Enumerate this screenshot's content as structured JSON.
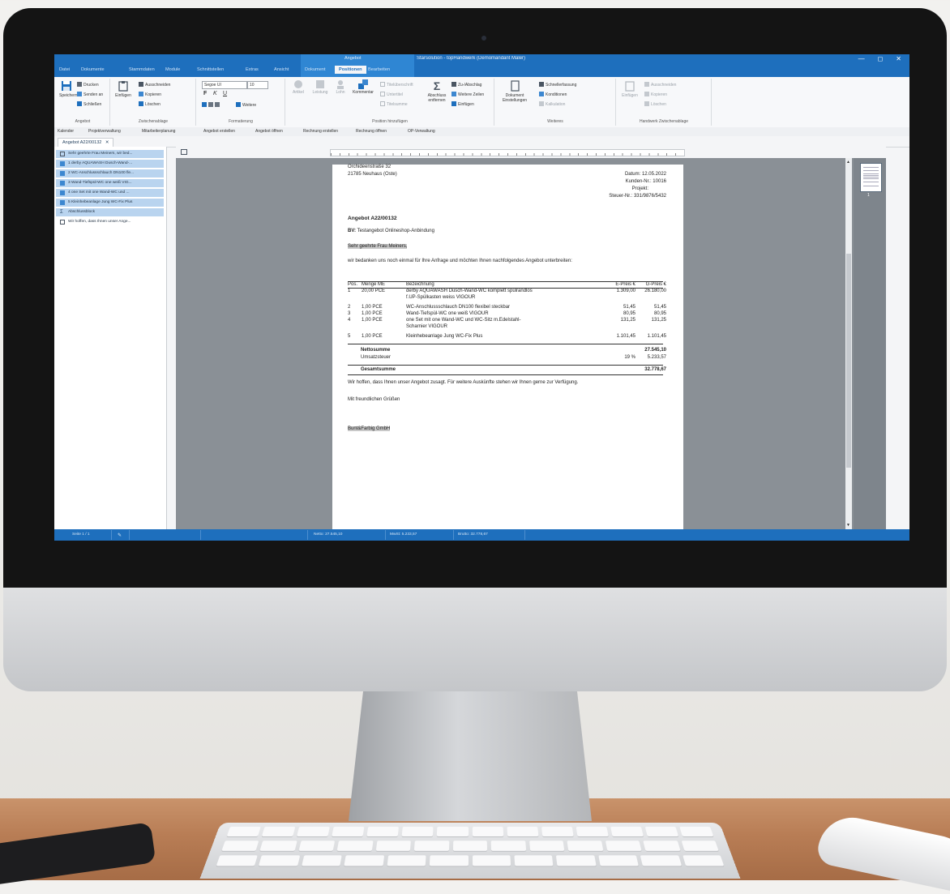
{
  "window": {
    "app_title": "Starsolution - topHandwerk (Demomandant Maler)",
    "context_group": "Angebot",
    "minimize": "—",
    "maximize": "◻",
    "close": "✕"
  },
  "ribbon_tabs": [
    "Datei",
    "Dokumente",
    "Stammdaten",
    "Module",
    "Schnittstellen",
    "Extras",
    "Ansicht",
    "Dokument",
    "Positionen",
    "Bearbeiten"
  ],
  "ribbon": {
    "angebot": {
      "label": "Angebot",
      "speichern": "Speichern",
      "drucken": "Drucken",
      "senden": "Senden an",
      "schliessen": "Schließen"
    },
    "zwischenablage": {
      "label": "Zwischenablage",
      "einfuegen": "Einfügen",
      "ausschneiden": "Ausschneiden",
      "kopieren": "Kopieren",
      "loeschen": "Löschen"
    },
    "formatierung": {
      "label": "Formatierung",
      "font": "Segoe UI",
      "size": "10",
      "bold": "F",
      "italic": "K",
      "underline": "U",
      "weitere": "Weitere"
    },
    "position": {
      "label": "Position hinzufügen",
      "artikel": "Artikel",
      "leistung": "Leistung",
      "lohn": "Lohn",
      "kommentar": "Kommentar",
      "titelueberschrift": "Titelüberschrift",
      "untertitel": "Untertitel",
      "titelsumme": "Titelsumme",
      "abschluss": "Abschluss entfernen",
      "zuabschlag": "Zu-/Abschlag",
      "weitere_zeilen": "Weitere Zeilen",
      "einfuegen": "Einfügen"
    },
    "weiteres": {
      "label": "Weiteres",
      "dokument_einstellungen": "Dokument Einstellungen",
      "schnellerfassung": "Schnellerfassung",
      "konditionen": "Konditionen",
      "kalkulation": "Kalkulation"
    },
    "handwerk": {
      "label": "Handwerk Zwischenablage",
      "einfuegen": "Einfügen",
      "ausschneiden": "Ausschneiden",
      "kopieren": "Kopieren",
      "loeschen": "Löschen"
    }
  },
  "quickbar": [
    "Kalender",
    "Projektverwaltung",
    "Mitarbeiterplanung",
    "Angebot erstellen",
    "Angebot öffnen",
    "Rechnung erstellen",
    "Rechnung öffnen",
    "OP-Verwaltung"
  ],
  "document_tab": "Angebot A22/00132",
  "nav_items": [
    "Sehr geehrte Frau Meiners, wir bed...",
    "1 derby AQUAWASH Dusch-Wand-...",
    "2 WC-Anschlussschlauch DN100 fle...",
    "3 Wand-Tiefspül-WC one weiß VIG...",
    "4 one Set mit one Wand-WC und ...",
    "5 Kleinhebeanlage Jung WC-Fix Plus",
    "Abschlussblock",
    "Wir hoffen, dass Ihnen unser Ange..."
  ],
  "doc": {
    "address_street": "Orchideenstraße 32",
    "address_city": "21785 Neuhaus (Oste)",
    "datum": "Datum: 12.05.2022",
    "kunden_nr": "Kunden-Nr.: 10016",
    "projekt": "Projekt:",
    "steuer_nr": "Steuer-Nr.: 331/9876/5432",
    "title": "Angebot A22/00132",
    "bv_label": "BV:",
    "bv_text": "Testangebot Onlineshop-Anbindung",
    "salutation": "Sehr geehrte Frau Meiners,",
    "intro": "wir bedanken uns noch einmal für Ihre Anfrage und möchten Ihnen nachfolgendes Angebot unterbreiten:",
    "table_headers": [
      "Pos.",
      "Menge ME",
      "Bezeichnung",
      "E-Preis €",
      "G-Preis €"
    ],
    "rows": [
      {
        "pos": "1",
        "menge": "20,00 PCE",
        "bez": "derby AQUAWASH Dusch-Wand-WC komplett spülrandlos",
        "bez2": "f.UP-Spülkasten weiss VIGOUR",
        "ep": "1.309,00",
        "gp": "26.180,00"
      },
      {
        "pos": "2",
        "menge": "1,00 PCE",
        "bez": "WC-Anschlussschlauch DN100 flexibel steckbar",
        "bez2": "",
        "ep": "51,45",
        "gp": "51,45"
      },
      {
        "pos": "3",
        "menge": "1,00 PCE",
        "bez": "Wand-Tiefspül-WC one weiß VIGOUR",
        "bez2": "",
        "ep": "80,95",
        "gp": "80,95"
      },
      {
        "pos": "4",
        "menge": "1,00 PCE",
        "bez": "one Set mit one Wand-WC und WC-Sitz m.Edelstahl-",
        "bez2": "Scharnier VIGOUR",
        "ep": "131,25",
        "gp": "131,25"
      },
      {
        "pos": "5",
        "menge": "1,00 PCE",
        "bez": "Kleinhebeanlage Jung WC-Fix Plus",
        "bez2": "",
        "ep": "1.101,45",
        "gp": "1.101,45"
      }
    ],
    "netto_label": "Nettosumme",
    "netto_value": "27.545,10",
    "ust_label": "Umsatzsteuer",
    "ust_rate": "19 %",
    "ust_value": "5.233,57",
    "gesamt_label": "Gesamtsumme",
    "gesamt_value": "32.778,67",
    "closing": "Wir hoffen, dass Ihnen unser Angebot zusagt. Für weitere Auskünfte stehen wir Ihnen gerne zur Verfügung.",
    "greeting": "Mit freundlichen Grüßen",
    "company": "Bunt&Farbig GmbH"
  },
  "thumbnail_page": "1",
  "status": {
    "page": "Seite 1 / 1",
    "netto": "Netto: 27.545,10",
    "mwst": "MwSt: 5.233,57",
    "brutto": "Brutto: 32.778,67"
  },
  "colors": {
    "accent": "#1e6fbd",
    "selection": "#b9d4ef",
    "document_bg": "#8a9096"
  }
}
